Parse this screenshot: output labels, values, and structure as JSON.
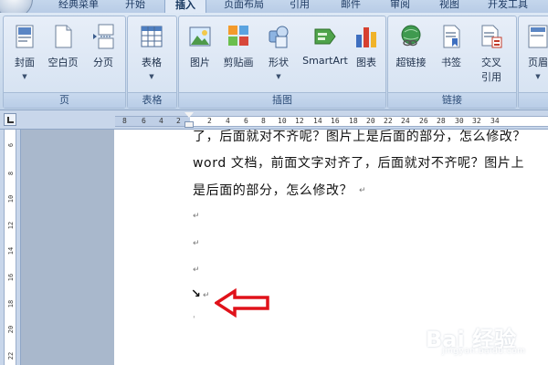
{
  "tabs": [
    {
      "label": "经典菜单",
      "active": false
    },
    {
      "label": "开始",
      "active": false
    },
    {
      "label": "插入",
      "active": true
    },
    {
      "label": "页面布局",
      "active": false
    },
    {
      "label": "引用",
      "active": false
    },
    {
      "label": "邮件",
      "active": false
    },
    {
      "label": "审阅",
      "active": false
    },
    {
      "label": "视图",
      "active": false
    },
    {
      "label": "开发工具",
      "active": false
    }
  ],
  "ribbon": {
    "groups": [
      {
        "label": "页",
        "buttons": [
          {
            "label": "封面",
            "icon": "cover-page-icon",
            "dropdown": true
          },
          {
            "label": "空白页",
            "icon": "blank-page-icon",
            "dropdown": false
          },
          {
            "label": "分页",
            "icon": "page-break-icon",
            "dropdown": false
          }
        ]
      },
      {
        "label": "表格",
        "buttons": [
          {
            "label": "表格",
            "icon": "table-icon",
            "dropdown": true
          }
        ]
      },
      {
        "label": "插图",
        "buttons": [
          {
            "label": "图片",
            "icon": "picture-icon",
            "dropdown": false
          },
          {
            "label": "剪贴画",
            "icon": "clip-art-icon",
            "dropdown": false
          },
          {
            "label": "形状",
            "icon": "shapes-icon",
            "dropdown": true
          },
          {
            "label": "SmartArt",
            "icon": "smartart-icon",
            "dropdown": false
          },
          {
            "label": "图表",
            "icon": "chart-icon",
            "dropdown": false
          }
        ]
      },
      {
        "label": "链接",
        "buttons": [
          {
            "label": "超链接",
            "icon": "hyperlink-icon",
            "dropdown": false
          },
          {
            "label": "书签",
            "icon": "bookmark-icon",
            "dropdown": false
          },
          {
            "label": "交叉",
            "label2": "引用",
            "icon": "cross-reference-icon",
            "dropdown": false
          }
        ]
      },
      {
        "label": "",
        "buttons": [
          {
            "label": "页眉",
            "icon": "header-icon",
            "dropdown": true
          }
        ]
      }
    ]
  },
  "ruler": {
    "horizontal_ticks": [
      "8",
      "6",
      "4",
      "2",
      "2",
      "4",
      "6",
      "8",
      "10",
      "12",
      "14",
      "16",
      "18",
      "20",
      "22",
      "24",
      "26",
      "28",
      "30",
      "32",
      "34"
    ],
    "vertical_ticks": [
      "6",
      "8",
      "10",
      "12",
      "14",
      "16",
      "18",
      "20",
      "22"
    ]
  },
  "document": {
    "lines": [
      "了，后面就对不齐呢？图片上是后面的部分，怎么修改？",
      "word 文档，前面文字对齐了，后面就对不齐呢？图片上",
      "是后面的部分，怎么修改？"
    ],
    "paragraph_mark": "↵",
    "arrow_mark": "↘",
    "small_mark": "ˌ"
  },
  "watermark": {
    "brand": "Bai 经验",
    "site": "jingyan.baidu.com"
  },
  "colors": {
    "annotation_arrow": "#e0121a",
    "ribbon_bg": "#d4e1f1",
    "document_bg": "#ffffff"
  }
}
